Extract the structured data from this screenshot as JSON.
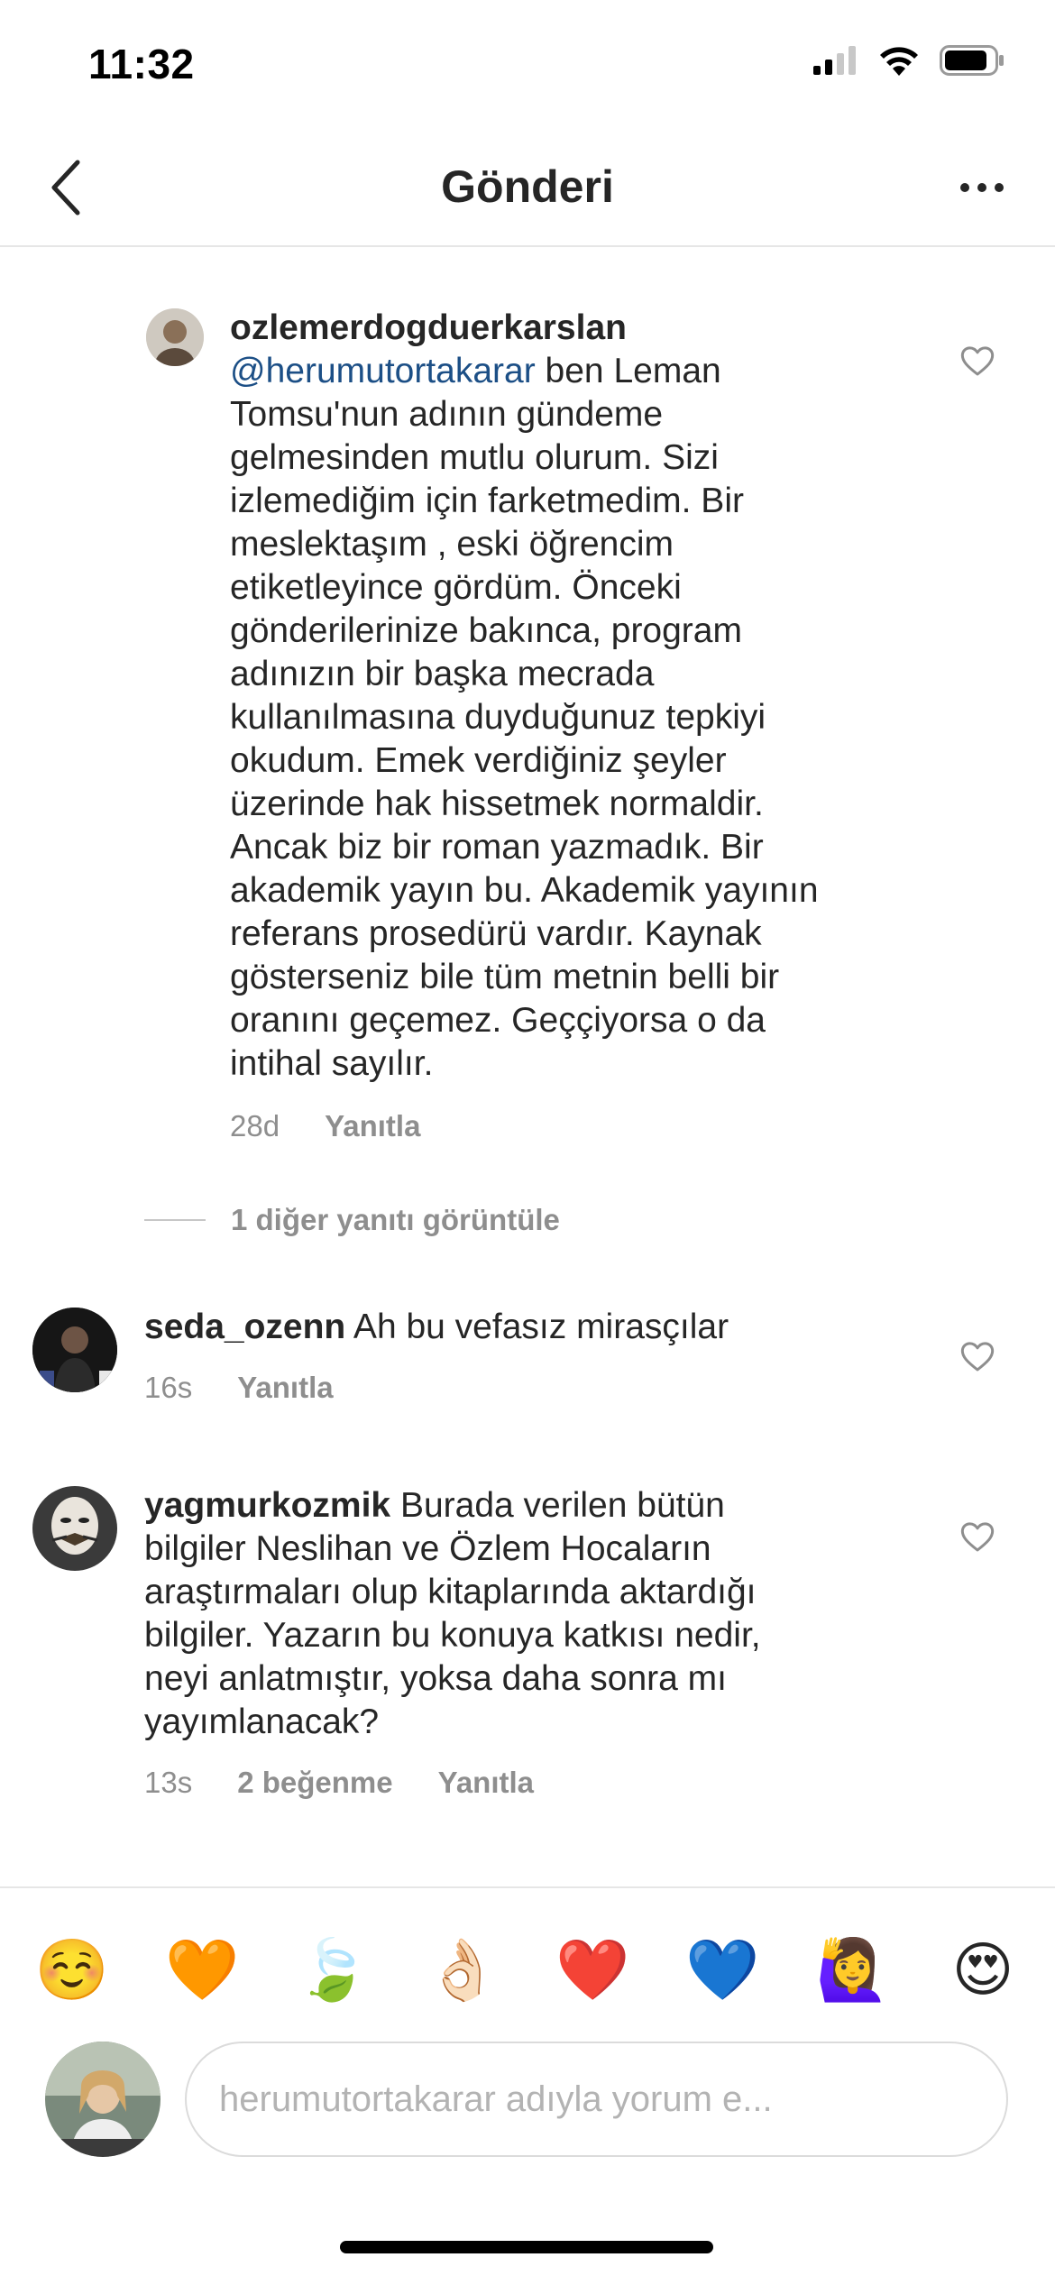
{
  "status_bar": {
    "time": "11:32",
    "icons": [
      "signal-icon",
      "wifi-icon",
      "battery-icon"
    ]
  },
  "nav": {
    "title": "Gönderi",
    "back_icon": "chevron-left-icon",
    "more_icon": "more-horizontal-icon"
  },
  "comments": [
    {
      "username": "ozlemerdogduerkarslan",
      "mention": "@herumutortakarar",
      "lines": [
        " ben Leman",
        "Tomsu'nun adının gündeme",
        "gelmesinden mutlu olurum. Sizi",
        "izlemediğim için farketmedim. Bir",
        "meslektaşım , eski öğrencim",
        "etiketleyince gördüm. Önceki",
        "gönderilerinize bakınca, program",
        "adınızın bir başka mecrada",
        "kullanılmasına duyduğunuz tepkiyi",
        "okudum. Emek verdiğiniz şeyler",
        "üzerinde hak hissetmek normaldir.",
        "Ancak biz bir roman yazmadık. Bir",
        "akademik yayın bu. Akademik yayının",
        "referans prosedürü vardır. Kaynak",
        "gösterseniz bile tüm metnin belli bir",
        "oranını geçemez. Geççiyorsa o da",
        "intihal sayılır."
      ],
      "time": "28d",
      "reply": "Yanıtla"
    },
    {
      "username": "seda_ozenn",
      "text": " Ah bu vefasız mirasçılar",
      "time": "16s",
      "reply": "Yanıtla"
    },
    {
      "username": "yagmurkozmik",
      "lines": [
        " Burada verilen bütün",
        "bilgiler Neslihan ve Özlem Hocaların",
        "araştırmaları olup kitaplarında aktardığı",
        "bilgiler. Yazarın bu konuya katkısı nedir,",
        "neyi anlatmıştır, yoksa daha sonra mı",
        "yayımlanacak?"
      ],
      "time": "13s",
      "likes": "2 beğenme",
      "reply": "Yanıtla"
    }
  ],
  "view_replies": "1 diğer yanıtı görüntüle",
  "emoji_bar": [
    "☺️",
    "🧡",
    "🍃",
    "👌🏻",
    "❤️",
    "💙",
    "🙋‍♀️",
    "😍"
  ],
  "composer": {
    "placeholder": "herumutortakarar adıyla yorum e..."
  },
  "colors": {
    "mention": "#1c4f86",
    "secondary_text": "#8e8e8e",
    "primary_text": "#262626"
  }
}
